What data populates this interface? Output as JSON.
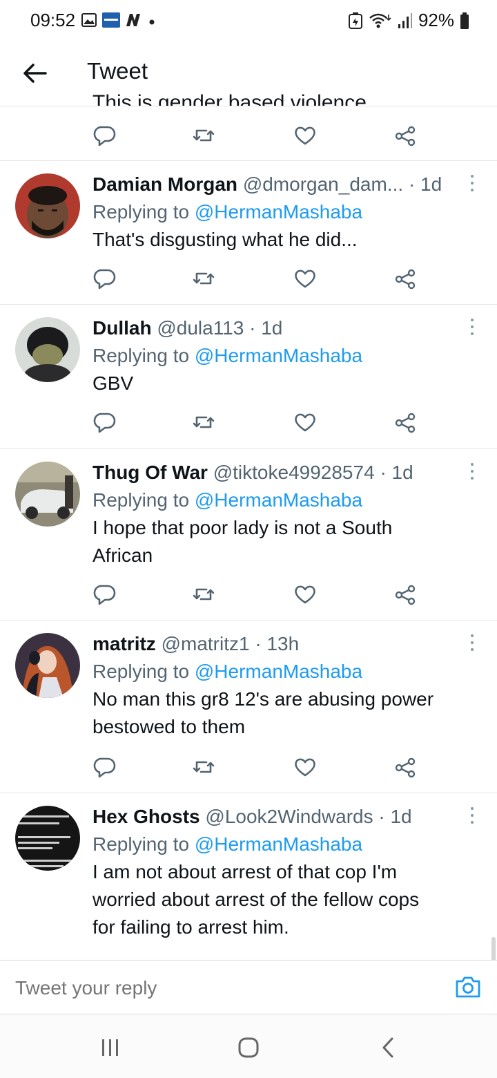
{
  "status": {
    "time": "09:52",
    "battery": "92%"
  },
  "header": {
    "title": "Tweet"
  },
  "cut_tweet": {
    "text": "This is gender based violence"
  },
  "replies": [
    {
      "name": "Damian Morgan",
      "handle": "@dmorgan_dam...",
      "time": "1d",
      "replying_prefix": "Replying to ",
      "replying_to": "@HermanMashaba",
      "text_lines": [
        "That's disgusting what he did..."
      ]
    },
    {
      "name": "Dullah",
      "handle": "@dula113",
      "time": "1d",
      "replying_prefix": "Replying to ",
      "replying_to": "@HermanMashaba",
      "text_lines": [
        "GBV"
      ]
    },
    {
      "name": "Thug Of War",
      "handle": "@tiktoke49928574",
      "time": "1d",
      "replying_prefix": "Replying to ",
      "replying_to": "@HermanMashaba",
      "text_lines": [
        "I hope that poor lady is not a South",
        "African"
      ]
    },
    {
      "name": "matritz",
      "handle": "@matritz1",
      "time": "13h",
      "replying_prefix": "Replying to ",
      "replying_to": "@HermanMashaba",
      "text_lines": [
        "No man this gr8 12's are abusing power",
        "bestowed to them"
      ]
    },
    {
      "name": "Hex Ghosts",
      "handle": "@Look2Windwards",
      "time": "1d",
      "replying_prefix": "Replying to ",
      "replying_to": "@HermanMashaba",
      "text_lines": [
        "I am not about arrest of that cop I'm",
        "worried about arrest of the fellow cops",
        "for failing to arrest him."
      ]
    }
  ],
  "compose": {
    "placeholder": "Tweet your reply"
  },
  "colors": {
    "accent": "#1d9bf0",
    "secondary_text": "#536471",
    "icon": "#536471"
  },
  "icons": [
    "back-arrow-icon",
    "reply-icon",
    "retweet-icon",
    "like-icon",
    "share-icon",
    "more-icon",
    "camera-icon"
  ]
}
